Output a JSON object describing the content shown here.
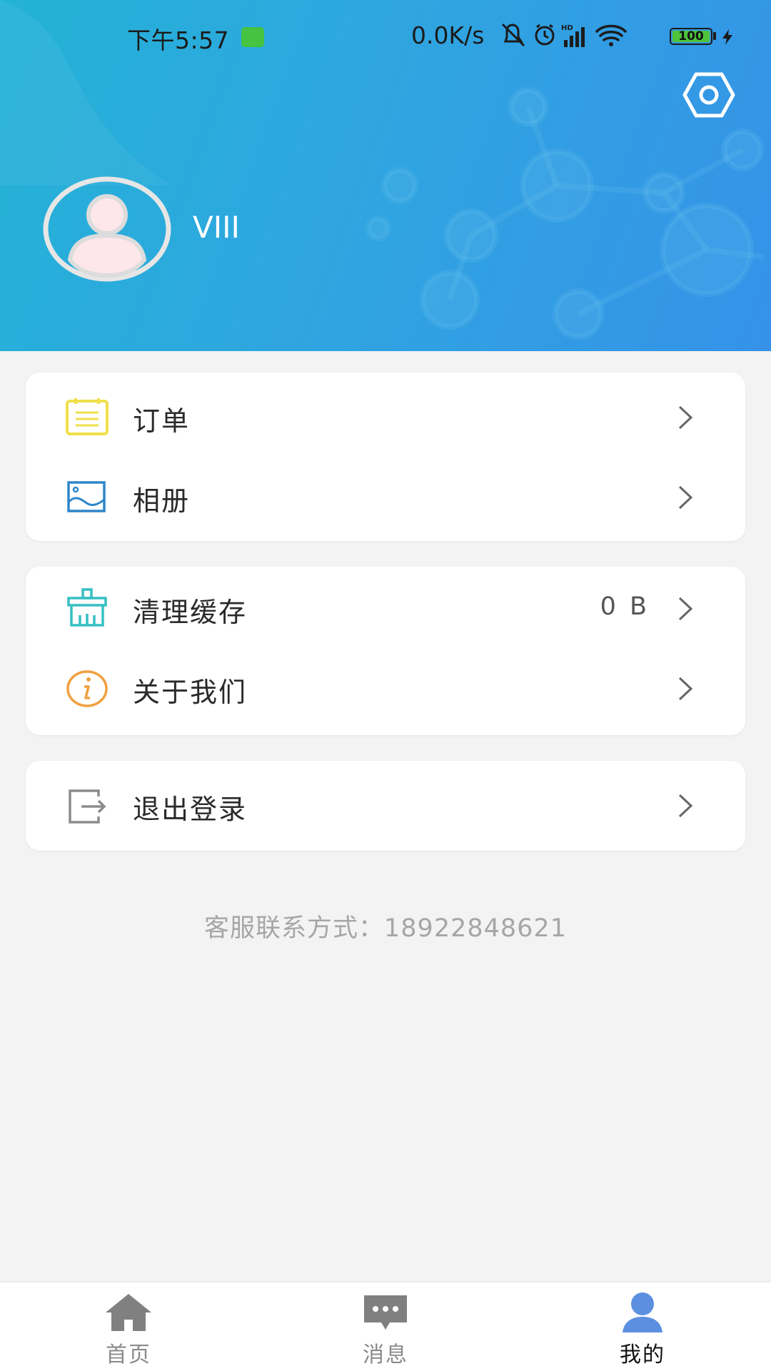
{
  "status_bar": {
    "time": "下午5:57",
    "net_speed": "0.0K/s",
    "battery": "100"
  },
  "header": {
    "username": "VIII",
    "settings_icon": "hexagon-settings-icon",
    "avatar_icon": "default-user-avatar"
  },
  "menu_groups": [
    {
      "items": [
        {
          "label": "订单",
          "icon": "order-list-icon",
          "value": ""
        },
        {
          "label": "相册",
          "icon": "photo-album-icon",
          "value": ""
        }
      ]
    },
    {
      "items": [
        {
          "label": "清理缓存",
          "icon": "broom-icon",
          "value": "0 B"
        },
        {
          "label": "关于我们",
          "icon": "info-icon",
          "value": ""
        }
      ]
    },
    {
      "items": [
        {
          "label": "退出登录",
          "icon": "logout-icon",
          "value": ""
        }
      ]
    }
  ],
  "contact": "客服联系方式：18922848621",
  "tabbar": {
    "tabs": [
      {
        "label": "首页",
        "icon": "home-icon",
        "active": false
      },
      {
        "label": "消息",
        "icon": "message-icon",
        "active": false
      },
      {
        "label": "我的",
        "icon": "user-icon",
        "active": true
      }
    ]
  },
  "colors": {
    "header_start": "#23b2d6",
    "header_end": "#3592e8",
    "order_icon": "#f0e04a",
    "album_icon": "#2e86c9",
    "broom_icon": "#36bfc4",
    "info_icon": "#f0a040",
    "logout_icon": "#8c8c8c",
    "active_tab": "#5b8fe0"
  }
}
